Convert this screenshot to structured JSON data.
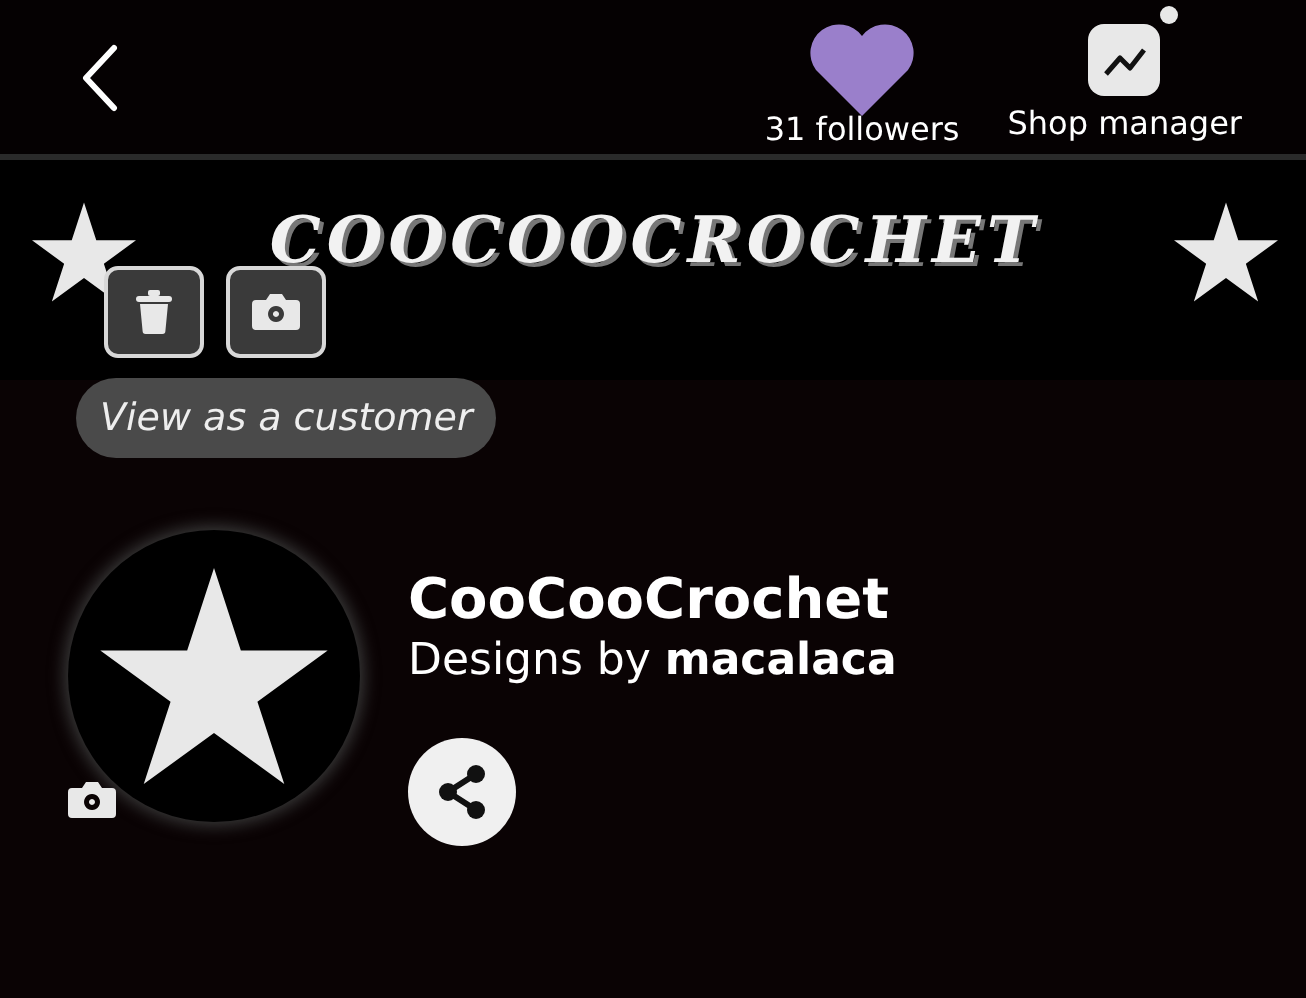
{
  "header": {
    "followers": {
      "label": "31 followers"
    },
    "shop_manager": {
      "label": "Shop manager",
      "notification": true
    }
  },
  "banner": {
    "title": "COOCOOCROCHET"
  },
  "view_as_customer": {
    "label": "View as a customer"
  },
  "shop": {
    "name": "CooCooCrochet",
    "byline": "Designs by **macalaca**"
  }
}
